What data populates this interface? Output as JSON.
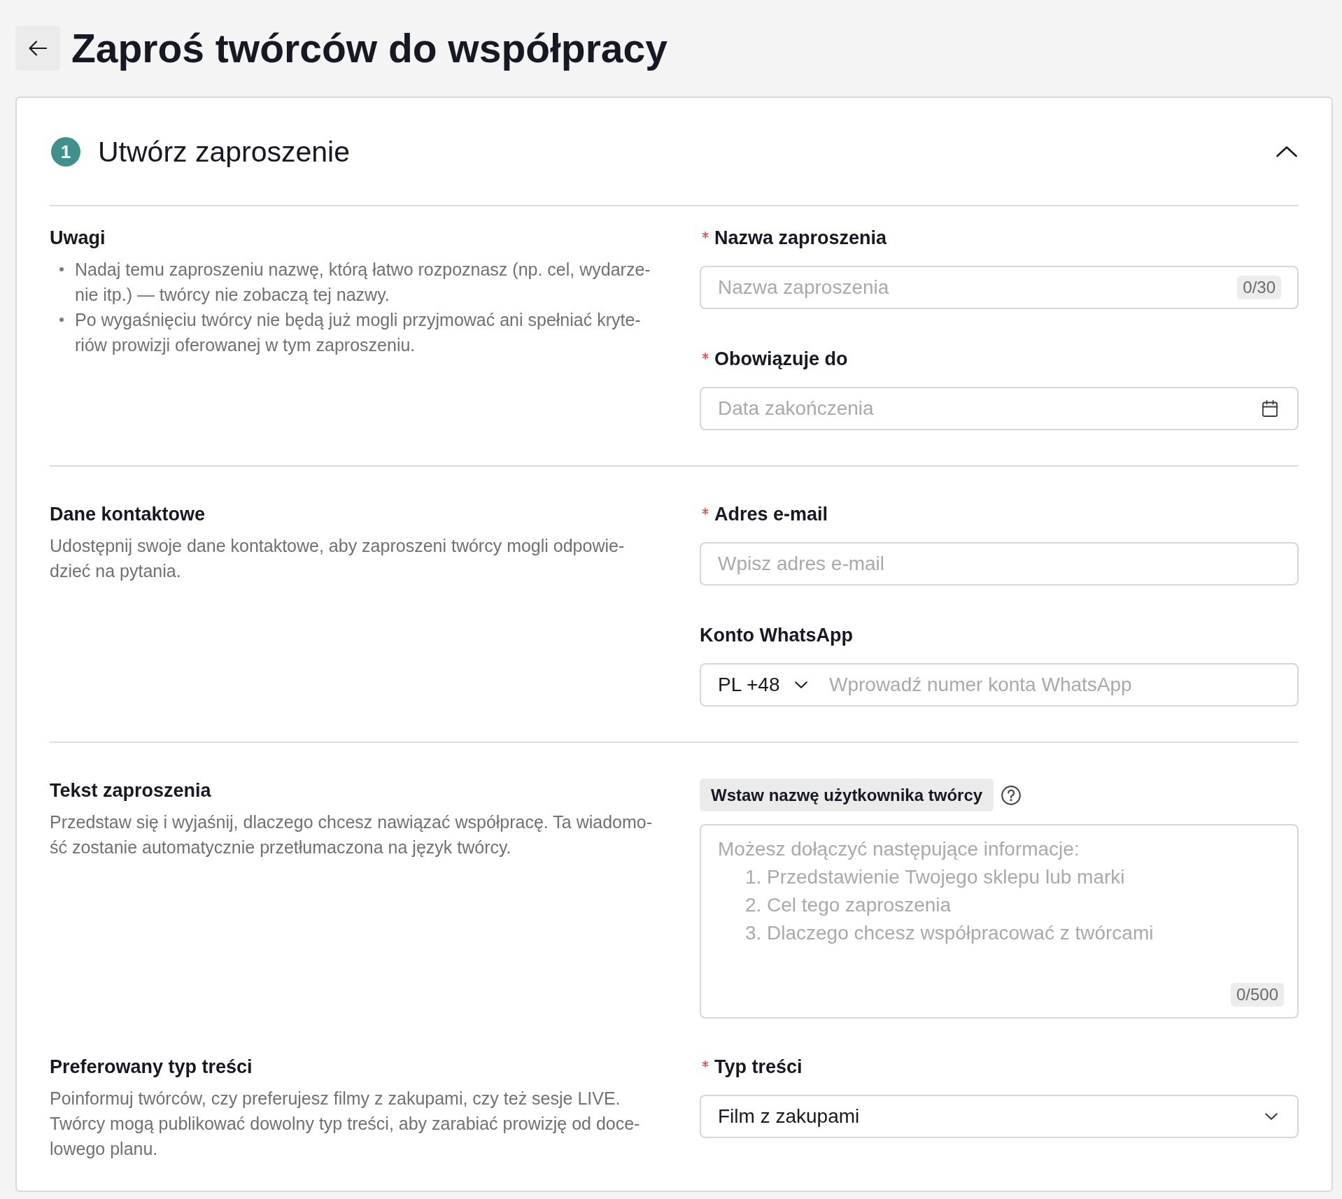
{
  "page_title": "Zaproś twórców do współpracy",
  "panel": {
    "step": "1",
    "title": "Utwórz zaproszenie",
    "expanded": true
  },
  "sections": [
    {
      "rows": [
        {
          "info": {
            "kind": "bullets",
            "title": "Uwagi",
            "bullets": [
              "Nadaj temu zaproszeniu nazwę, którą łatwo rozpoznasz (np. cel, wydarze-\nnie itp.) — twórcy nie zobaczą tej nazwy.",
              "Po wygaśnięciu twórcy nie będą już mogli przyjmować ani spełniać kryte-\nriów prowizji oferowanej w tym zaproszeniu."
            ]
          },
          "fields": [
            {
              "kind": "text",
              "label": "Nazwa zaproszenia",
              "required": true,
              "placeholder": "Nazwa zaproszenia",
              "counter": "0/30"
            },
            {
              "kind": "date",
              "label": "Obowiązuje do",
              "required": true,
              "placeholder": "Data zakończenia"
            }
          ]
        }
      ]
    },
    {
      "rows": [
        {
          "info": {
            "kind": "paragraph",
            "title": "Dane kontaktowe",
            "text": "Udostępnij swoje dane kontaktowe, aby zaproszeni twórcy mogli odpowie-\ndzieć na pytania."
          },
          "fields": [
            {
              "kind": "text",
              "label": "Adres e-mail",
              "required": true,
              "placeholder": "Wpisz adres e-mail"
            },
            {
              "kind": "phone",
              "label": "Konto WhatsApp",
              "required": false,
              "country_code": "PL +48",
              "placeholder": "Wprowadź numer konta WhatsApp"
            }
          ]
        }
      ]
    },
    {
      "rows": [
        {
          "info": {
            "kind": "paragraph",
            "title": "Tekst zaproszenia",
            "text": "Przedstaw się i wyjaśnij, dlaczego chcesz nawiązać współpracę. Ta wiadomo-\nść zostanie automatycznie przetłumaczona na język twórcy."
          },
          "fields": [
            {
              "kind": "textarea",
              "insert_button": "Wstaw nazwę użytkownika twórcy",
              "placeholder": "Możesz dołączyć następujące informacje:\n     1. Przedstawienie Twojego sklepu lub marki\n     2. Cel tego zaproszenia\n     3. Dlaczego chcesz współpracować z twórcami",
              "counter": "0/500"
            }
          ]
        },
        {
          "info": {
            "kind": "paragraph",
            "title": "Preferowany typ treści",
            "text": "Poinformuj twórców, czy preferujesz filmy z zakupami, czy też sesje LIVE.\nTwórcy mogą publikować dowolny typ treści, aby zarabiać prowizję od doce-\nlowego planu."
          },
          "fields": [
            {
              "kind": "select",
              "label": "Typ treści",
              "required": true,
              "value": "Film z zakupami"
            }
          ]
        }
      ]
    }
  ]
}
